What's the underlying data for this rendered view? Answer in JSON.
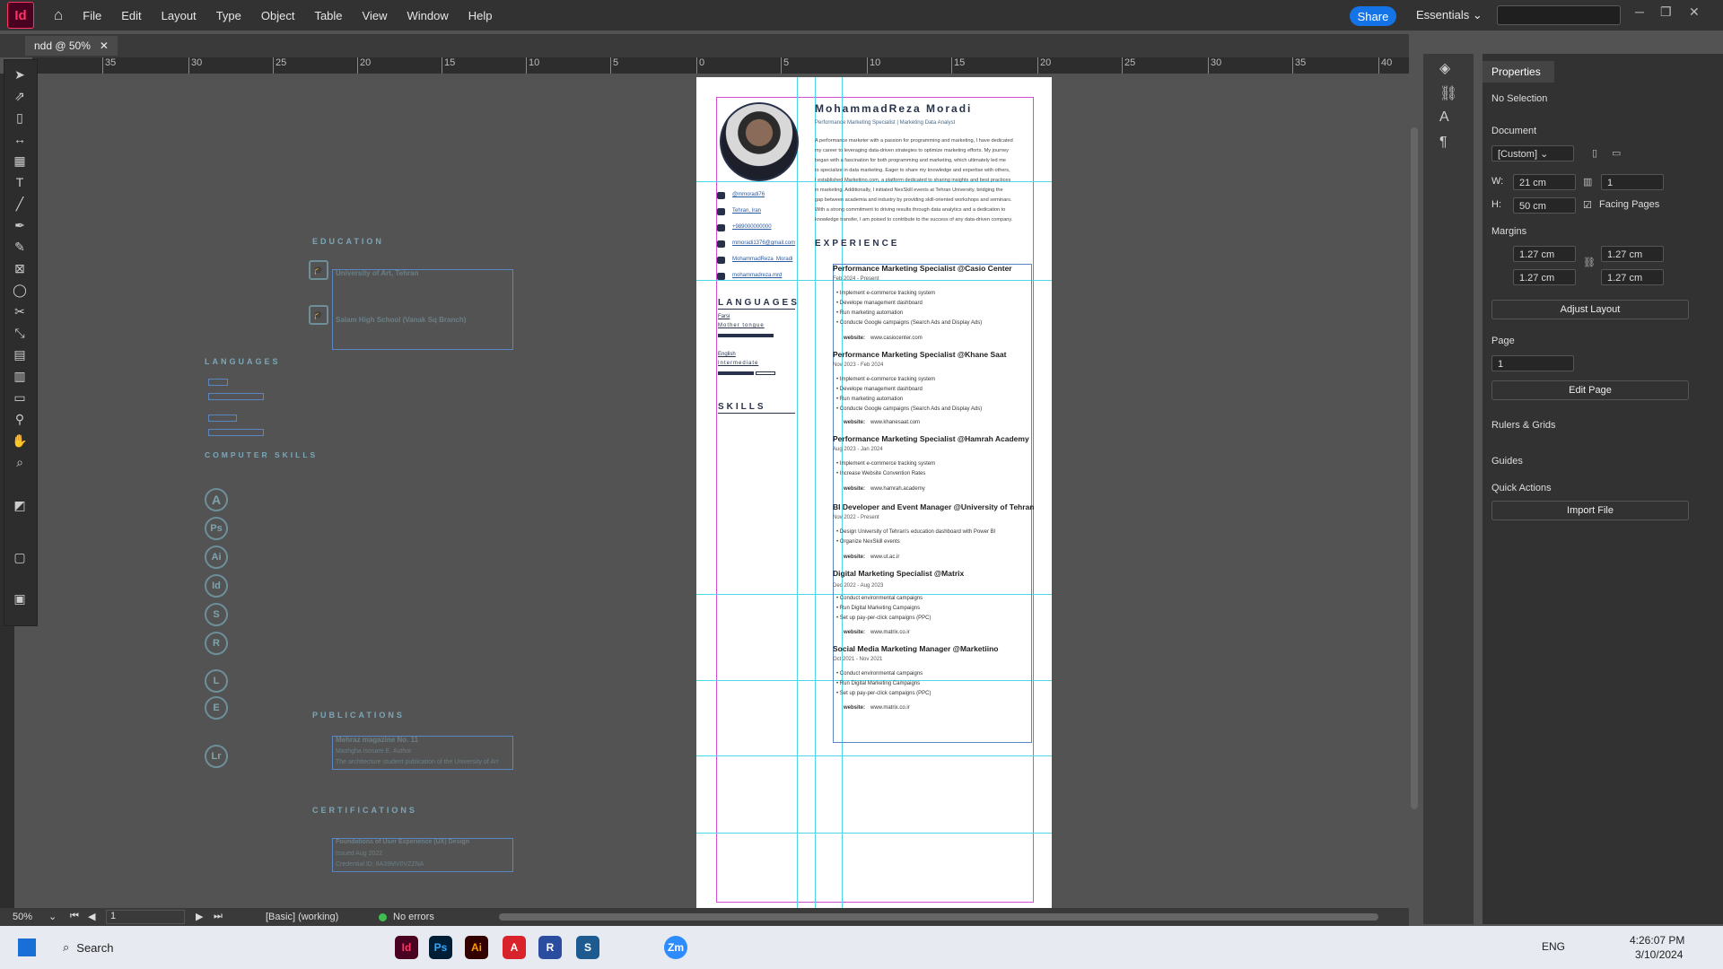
{
  "app": {
    "logo": "Id",
    "menu": [
      "File",
      "Edit",
      "Layout",
      "Type",
      "Object",
      "Table",
      "View",
      "Window",
      "Help"
    ],
    "share_label": "Share",
    "workspace": "Essentials"
  },
  "tab": {
    "title": "ndd @ 50%"
  },
  "ruler": {
    "ticks": [
      "35",
      "30",
      "25",
      "20",
      "15",
      "10",
      "5",
      "0",
      "5",
      "10",
      "15",
      "20",
      "25",
      "30",
      "35",
      "40"
    ]
  },
  "status": {
    "zoom": "50%",
    "page": "1",
    "style": "[Basic] (working)",
    "errors": "No errors"
  },
  "properties": {
    "title": "Properties",
    "selection": "No Selection",
    "document_label": "Document",
    "preset": "[Custom]",
    "w_label": "W:",
    "w_value": "21 cm",
    "h_label": "H:",
    "h_value": "50 cm",
    "pages_value": "1",
    "facing_pages": "Facing Pages",
    "margins_label": "Margins",
    "m_top": "1.27 cm",
    "m_bottom": "1.27 cm",
    "m_inside": "1.27 cm",
    "m_outside": "1.27 cm",
    "adjust_layout": "Adjust Layout",
    "page_label": "Page",
    "page_value": "1",
    "edit_page": "Edit Page",
    "rulers_grids": "Rulers & Grids",
    "guides": "Guides",
    "quick_actions": "Quick Actions",
    "import_file": "Import File"
  },
  "resume": {
    "name": "MohammadReza  Moradi",
    "subtitle": "Performance Marketing Specialist | Marketing Data Analyst",
    "summary": [
      "A performance marketer with a passion for programming and marketing, I have dedicated",
      "my career to leveraging data-driven strategies to optimize marketing efforts. My journey",
      "began with a fascination for both programming and marketing, which ultimately led me",
      "to specialize in data marketing. Eager to share my knowledge and expertise with others,",
      "I established Marketiino.com, a platform dedicated to sharing insights and best practices",
      "in marketing. Additionally, I initiated NexSkill events at Tehran University, bridging the",
      "gap between academia and industry by providing skill-oriented workshops and seminars.",
      "With a strong commitment to driving results through data analytics and a dedication to",
      "knowledge transfer, I am poised to contribute to the success of any data-driven company."
    ],
    "contacts": [
      "@mmoradi76",
      "Tehran, Iran",
      "+989000000000",
      "mmoradi1376@gmail.com",
      "MohammadReza_Moradi",
      "mohammadreza.mrd"
    ],
    "languages_title": "LANGUAGES",
    "languages": [
      "Farsi",
      "Mother tongue",
      "English",
      "Intermediate"
    ],
    "skills_title": "SKILLS",
    "experience_title": "EXPERIENCE",
    "jobs": [
      {
        "title": "Performance Marketing Specialist @Casio Center",
        "date": "Feb 2024 - Present",
        "bullets": [
          "Implement e-commerce tracking system",
          "Develope management dashboard",
          "Run marketing automation",
          "Conducte Google campaigns (Search Ads and Display Ads)"
        ],
        "website": "www.casiocenter.com"
      },
      {
        "title": "Performance Marketing Specialist @Khane Saat",
        "date": "Nov 2023 - Feb 2024",
        "bullets": [
          "Implement e-commerce tracking system",
          "Develope management dashboard",
          "Run marketing automation",
          "Conducte Google campaigns (Search Ads and Display Ads)"
        ],
        "website": "www.khanesaat.com"
      },
      {
        "title": "Performance Marketing Specialist @Hamrah Academy",
        "date": "Aug 2023 - Jan 2024",
        "bullets": [
          "Implement e-commerce tracking system",
          "Increase Website Convention Rates"
        ],
        "website": "www.hamrah.academy"
      },
      {
        "title": "BI Developer and Event Manager @University of Tehran",
        "date": "Nov 2022 - Present",
        "bullets": [
          "Design University of Tehran's education dashboard with Power BI",
          "Organize NexSkill events"
        ],
        "website": "www.ut.ac.ir"
      },
      {
        "title": "Digital Marketing Specialist @Matrix",
        "date": "Dec 2022 - Aug 2023",
        "bullets": [
          "Conduct environmental campaigns",
          "Run  Digital Marketing Campaigns",
          "Set up pay-per-click campaigns (PPC)"
        ],
        "website": "www.matrix.co.ir"
      },
      {
        "title": "Social Media Marketing Manager @Marketiino",
        "date": "Oct 2021 - Nov 2021",
        "bullets": [
          "Conduct environmental campaigns",
          "Run  Digital Marketing Campaigns",
          "Set up pay-per-click campaigns (PPC)"
        ],
        "website": "www.matrix.co.ir"
      }
    ],
    "website_label": "website:"
  },
  "pasteboard": {
    "education_title": "EDUCATION",
    "edu1": "University of Art, Tehran",
    "edu2": "Salam High School (Vanak Sq Branch)",
    "languages_title": "LANGUAGES",
    "computer_skills_title": "COMPUTER   SKILLS",
    "publications_title": "PUBLICATIONS",
    "pub1": "Mehraz magazine No. 11",
    "pub2": "Mashgha Isosare E. Author",
    "pub3": "The architecture student publication of the University of Art",
    "certifications_title": "CERTIFICATIONS",
    "cert1": "Foundations of User Experience (UX) Design",
    "cert2": "Issued Aug 2022",
    "cert3": "Credential ID: 8A39MV0VZZNA",
    "skill_icons": [
      "A",
      "Ps",
      "Ai",
      "Id",
      "R"
    ]
  },
  "taskbar": {
    "search": "Search",
    "time": "4:26:07 PM",
    "date": "3/10/2024",
    "lang": "ENG",
    "apps": [
      "Id",
      "Ps",
      "Ai",
      "A",
      "R",
      "S",
      "Zm"
    ]
  }
}
